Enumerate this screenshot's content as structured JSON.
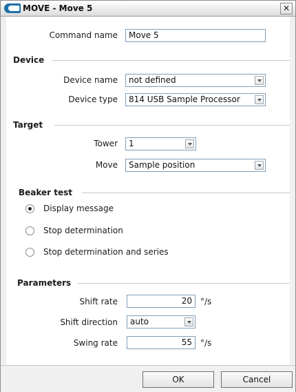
{
  "window": {
    "title": "MOVE - Move 5",
    "close_glyph": "✕",
    "icon": "app-logo-icon"
  },
  "command": {
    "label": "Command name",
    "value": "Move 5"
  },
  "device": {
    "heading": "Device",
    "name_label": "Device name",
    "name_value": "not defined",
    "type_label": "Device type",
    "type_value": "814 USB Sample Processor"
  },
  "target": {
    "heading": "Target",
    "tower_label": "Tower",
    "tower_value": "1",
    "move_label": "Move",
    "move_value": "Sample position"
  },
  "beaker_test": {
    "heading": "Beaker test",
    "options": [
      {
        "label": "Display message",
        "checked": true
      },
      {
        "label": "Stop determination",
        "checked": false
      },
      {
        "label": "Stop determination and series",
        "checked": false
      }
    ]
  },
  "parameters": {
    "heading": "Parameters",
    "shift_rate_label": "Shift rate",
    "shift_rate_value": "20",
    "shift_rate_unit": "°/s",
    "shift_direction_label": "Shift direction",
    "shift_direction_value": "auto",
    "swing_rate_label": "Swing rate",
    "swing_rate_value": "55",
    "swing_rate_unit": "°/s"
  },
  "buttons": {
    "ok": "OK",
    "cancel": "Cancel"
  }
}
